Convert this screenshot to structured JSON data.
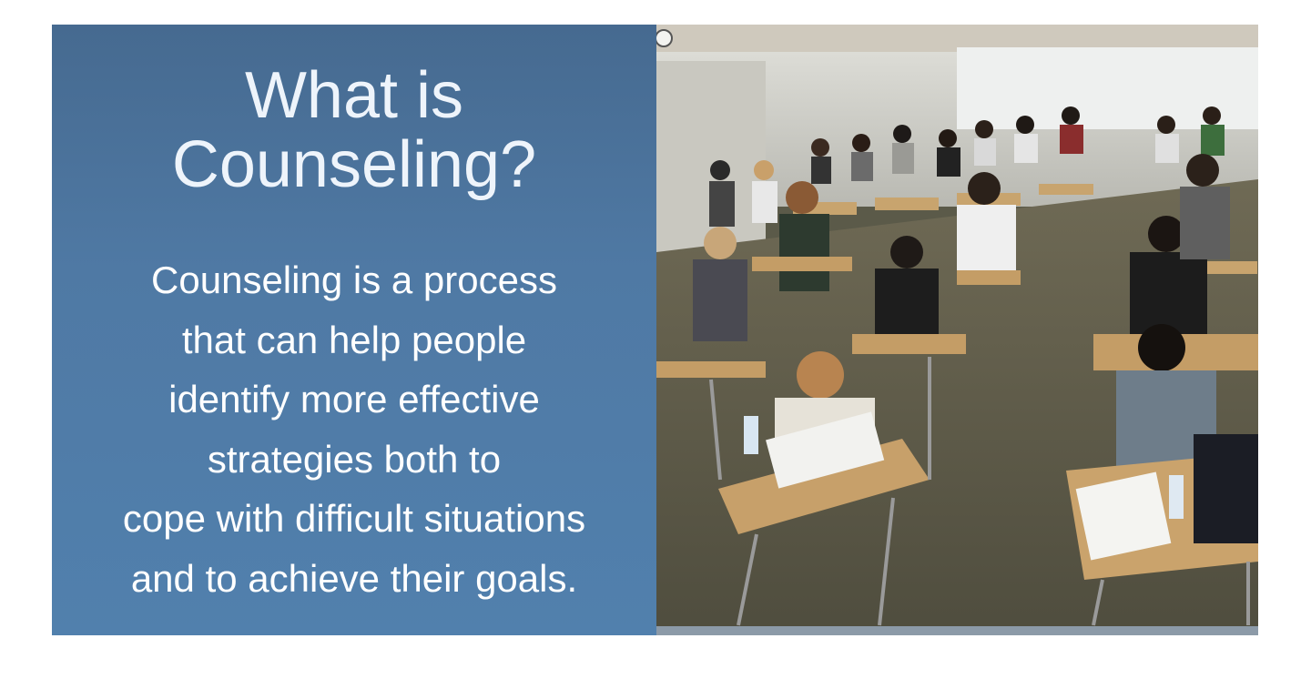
{
  "slide": {
    "title_lines": [
      "What is",
      "Counseling?"
    ],
    "body_lines": [
      "Counseling is a process",
      "that can help people",
      "identify more effective",
      "strategies both to",
      "cope with difficult situations",
      "and to achieve their goals."
    ],
    "panel_color": "#4f79a4",
    "photo": "students-in-classroom-photo"
  }
}
